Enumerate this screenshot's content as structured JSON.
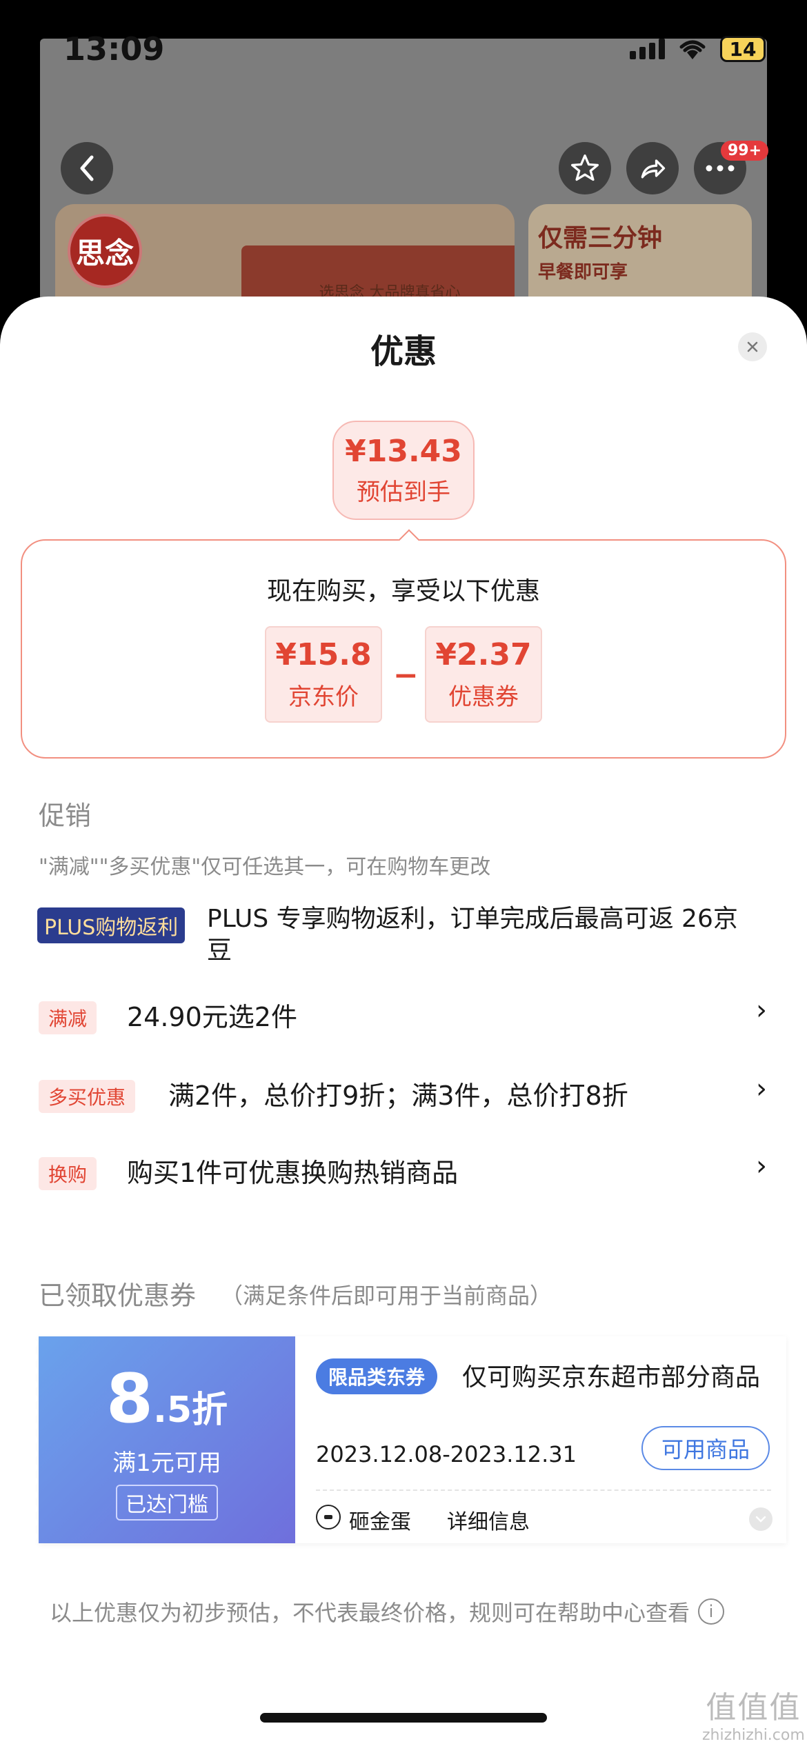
{
  "status_bar": {
    "time": "13:09",
    "battery": "14"
  },
  "background": {
    "badge": "99+",
    "brand_logo": "思念",
    "product_label": "选思念 大品牌真省心",
    "banner_title": "仅需三分钟",
    "banner_sub": "早餐即可享"
  },
  "sheet": {
    "title": "优惠",
    "estimate": {
      "price": "¥13.43",
      "label": "预估到手"
    },
    "breakdown": {
      "heading": "现在购买，享受以下优惠",
      "minus": "−",
      "items": [
        {
          "value": "¥15.8",
          "label": "京东价"
        },
        {
          "value": "¥2.37",
          "label": "优惠券"
        }
      ]
    },
    "promotions": {
      "title": "促销",
      "note": "\"满减\"\"多买优惠\"仅可任选其一，可在购物车更改",
      "plus_tag": "PLUS购物返利",
      "plus_text": "PLUS 专享购物返利，订单完成后最高可返 26京豆",
      "rows": [
        {
          "tag": "满减",
          "text": "24.90元选2件"
        },
        {
          "tag": "多买优惠",
          "text": "满2件，总价打9折；满3件，总价打8折"
        },
        {
          "tag": "换购",
          "text": "购买1件可优惠换购热销商品"
        }
      ],
      "chevron": "›"
    },
    "coupons": {
      "title": "已领取优惠券",
      "subtitle": "（满足条件后即可用于当前商品）",
      "coupon": {
        "discount_main": "8",
        "discount_rest": ".5折",
        "condition": "满1元可用",
        "status": "已达门槛",
        "type": "限品类东券",
        "desc": "仅可购买京东超市部分商品",
        "date": "2023.12.08-2023.12.31",
        "usable_btn": "可用商品",
        "egg_label": "砸金蛋",
        "detail_label": "详细信息"
      }
    },
    "disclaimer": "以上优惠仅为初步预估，不代表最终价格，规则可在帮助中心查看"
  },
  "watermark": {
    "big": "值值值",
    "small": "zhizhizhi.com"
  },
  "colors": {
    "accent": "#e14533",
    "coupon_blue": "#6f86e4",
    "plus_navy": "#2b3c8e"
  }
}
